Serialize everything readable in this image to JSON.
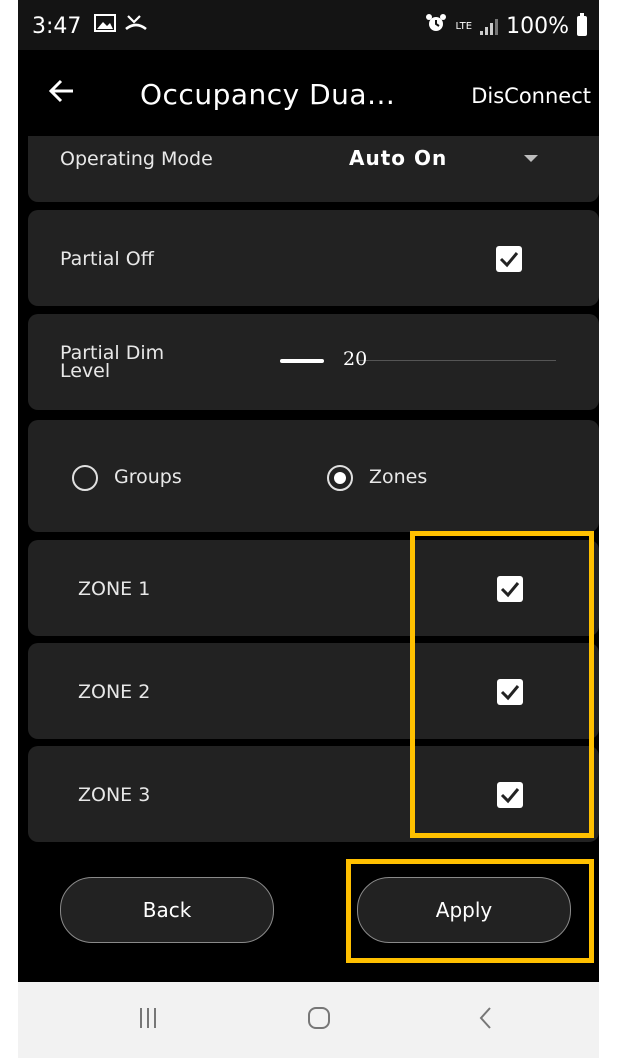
{
  "status_bar": {
    "time": "3:47",
    "lte": "LTE",
    "battery": "100%"
  },
  "app_bar": {
    "title": "Occupancy Dua...",
    "disconnect": "DisConnect"
  },
  "settings": {
    "operating_mode": {
      "label": "Operating Mode",
      "value": "Auto On"
    },
    "partial_off": {
      "label": "Partial Off",
      "checked": true
    },
    "partial_dim": {
      "label_line1": "Partial Dim",
      "label_line2": "Level",
      "value": "20"
    },
    "target": {
      "options": [
        "Groups",
        "Zones"
      ],
      "selected": "Zones"
    },
    "zones": [
      {
        "label": "ZONE 1",
        "checked": true
      },
      {
        "label": "ZONE 2",
        "checked": true
      },
      {
        "label": "ZONE 3",
        "checked": true
      }
    ]
  },
  "buttons": {
    "back": "Back",
    "apply": "Apply"
  },
  "colors": {
    "highlight": "#ffc000",
    "panel": "#222222",
    "background": "#000000"
  },
  "icons": {
    "gallery": "image-icon",
    "missed_call": "missed-call-icon",
    "alarm": "alarm-icon",
    "signal": "signal-icon",
    "battery": "battery-icon"
  }
}
